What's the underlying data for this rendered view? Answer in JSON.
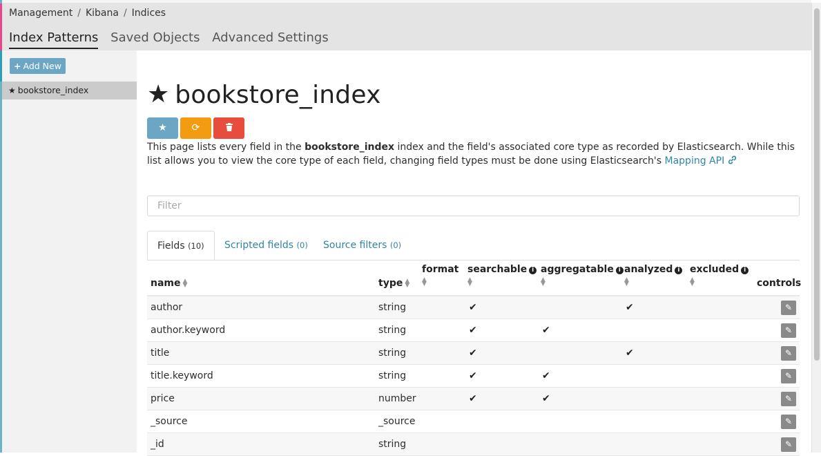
{
  "breadcrumb": [
    "Management",
    "Kibana",
    "Indices"
  ],
  "subnav": {
    "tabs": [
      "Index Patterns",
      "Saved Objects",
      "Advanced Settings"
    ],
    "active": "Index Patterns"
  },
  "sidebar": {
    "add_new_label": "Add New",
    "items": [
      {
        "label": "bookstore_index",
        "starred": true
      }
    ]
  },
  "main": {
    "title": "bookstore_index",
    "description": {
      "prefix": "This page lists every field in the ",
      "index_name": "bookstore_index",
      "middle": " index and the field's associated core type as recorded by Elasticsearch. While this list allows you to view the core type of each field, changing field types must be done using Elasticsearch's ",
      "link": "Mapping API"
    },
    "filter_placeholder": "Filter",
    "tabs": {
      "fields_label": "Fields",
      "fields_count": "(10)",
      "scripted_label": "Scripted fields",
      "scripted_count": "(0)",
      "source_label": "Source filters",
      "source_count": "(0)"
    },
    "table": {
      "headers": {
        "name": "name",
        "type": "type",
        "format": "format",
        "searchable": "searchable",
        "aggregatable": "aggregatable",
        "analyzed": "analyzed",
        "excluded": "excluded",
        "controls": "controls"
      },
      "rows": [
        {
          "name": "author",
          "type": "string",
          "searchable": true,
          "aggregatable": false,
          "analyzed": true,
          "excluded": false
        },
        {
          "name": "author.keyword",
          "type": "string",
          "searchable": true,
          "aggregatable": true,
          "analyzed": false,
          "excluded": false
        },
        {
          "name": "title",
          "type": "string",
          "searchable": true,
          "aggregatable": false,
          "analyzed": true,
          "excluded": false
        },
        {
          "name": "title.keyword",
          "type": "string",
          "searchable": true,
          "aggregatable": true,
          "analyzed": false,
          "excluded": false
        },
        {
          "name": "price",
          "type": "number",
          "searchable": true,
          "aggregatable": true,
          "analyzed": false,
          "excluded": false
        },
        {
          "name": "_source",
          "type": "_source",
          "searchable": false,
          "aggregatable": false,
          "analyzed": false,
          "excluded": false
        },
        {
          "name": "_id",
          "type": "string",
          "searchable": false,
          "aggregatable": false,
          "analyzed": false,
          "excluded": false
        }
      ]
    }
  },
  "icons": {
    "star": "star-icon",
    "refresh": "refresh-icon",
    "delete": "trash-icon",
    "link": "link-icon",
    "info": "info-icon",
    "edit": "pencil-icon",
    "plus": "plus-icon"
  },
  "colors": {
    "accent_blue": "#6ba6c5",
    "refresh_orange": "#f39c12",
    "delete_red": "#e74c3c",
    "link": "#3085a6",
    "header_bg": "#e4e4e4",
    "sidebar_bg": "#f2f2f2"
  }
}
